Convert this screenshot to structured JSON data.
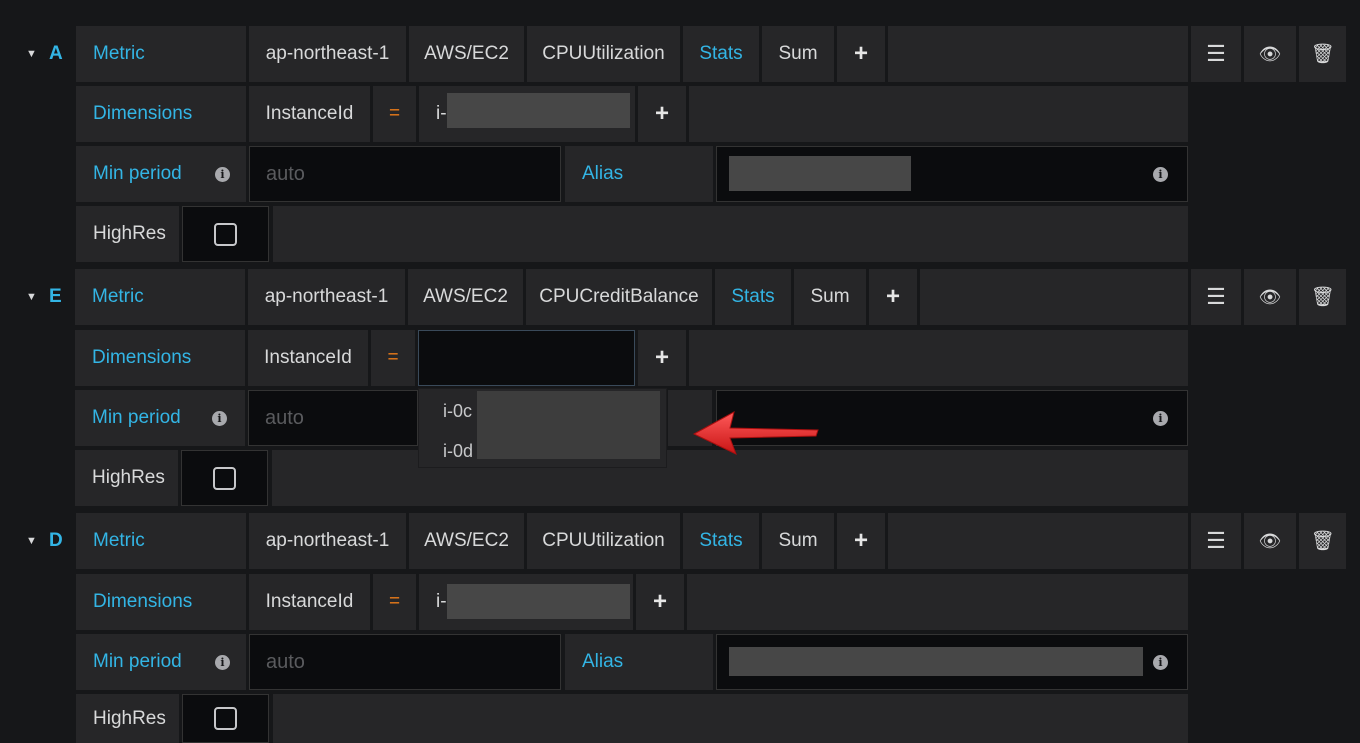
{
  "queries": [
    {
      "letter": "A",
      "metric_label": "Metric",
      "region": "ap-northeast-1",
      "namespace": "AWS/EC2",
      "metric_name": "CPUUtilization",
      "stats_label": "Stats",
      "stat": "Sum",
      "dimensions_label": "Dimensions",
      "dimension_key": "InstanceId",
      "operator": "=",
      "dimension_value": "i-",
      "min_period_label": "Min period",
      "min_period_placeholder": "auto",
      "alias_label": "Alias",
      "highres_label": "HighRes"
    },
    {
      "letter": "E",
      "metric_label": "Metric",
      "region": "ap-northeast-1",
      "namespace": "AWS/EC2",
      "metric_name": "CPUCreditBalance",
      "stats_label": "Stats",
      "stat": "Sum",
      "dimensions_label": "Dimensions",
      "dimension_key": "InstanceId",
      "operator": "=",
      "dimension_value": "",
      "min_period_label": "Min period",
      "min_period_placeholder": "auto",
      "highres_label": "HighRes",
      "dropdown_options": [
        "i-0c",
        "i-0d"
      ]
    },
    {
      "letter": "D",
      "metric_label": "Metric",
      "region": "ap-northeast-1",
      "namespace": "AWS/EC2",
      "metric_name": "CPUUtilization",
      "stats_label": "Stats",
      "stat": "Sum",
      "dimensions_label": "Dimensions",
      "dimension_key": "InstanceId",
      "operator": "=",
      "dimension_value": "i-",
      "min_period_label": "Min period",
      "min_period_placeholder": "auto",
      "alias_label": "Alias",
      "highres_label": "HighRes"
    }
  ],
  "icons": {
    "collapse": "caret-down-icon",
    "add": "plus-icon",
    "menu": "hamburger-icon",
    "toggle_visibility": "eye-icon",
    "delete": "trash-icon",
    "info": "info-icon",
    "annotation": "red-arrow"
  },
  "colors": {
    "accent": "#33b5e5",
    "operator": "#eb7b18",
    "panel": "#262628",
    "background": "#161719",
    "arrow": "#e0262a"
  }
}
